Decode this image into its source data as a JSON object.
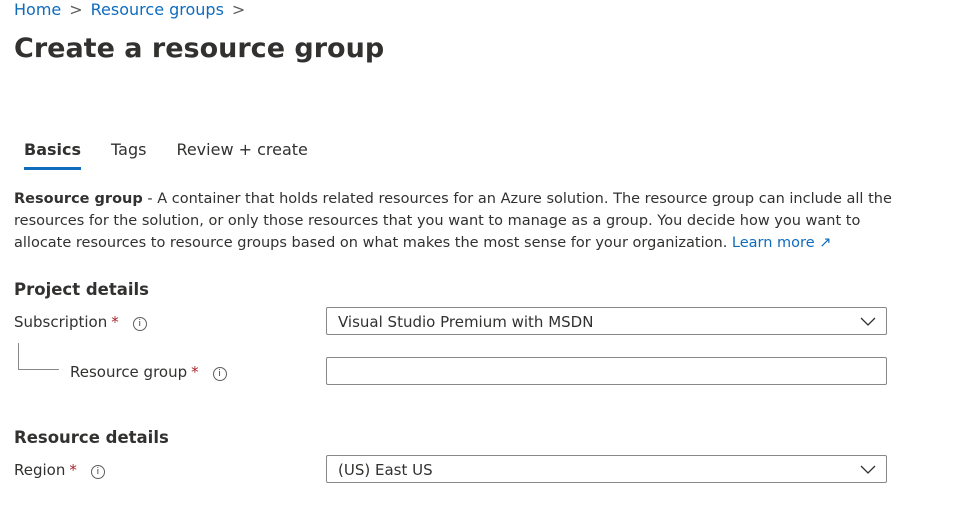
{
  "breadcrumb": [
    {
      "label": "Home"
    },
    {
      "label": "Resource groups"
    }
  ],
  "title": "Create a resource group",
  "tabs": [
    {
      "label": "Basics",
      "active": true
    },
    {
      "label": "Tags"
    },
    {
      "label": "Review + create"
    }
  ],
  "description": {
    "bold": "Resource group",
    "text": " - A container that holds related resources for an Azure solution. The resource group can include all the resources for the solution, or only those resources that you want to manage as a group. You decide how you want to allocate resources to resource groups based on what makes the most sense for your organization. ",
    "link": "Learn more"
  },
  "project_details": {
    "heading": "Project details",
    "subscription": {
      "label": "Subscription",
      "value": "Visual Studio Premium with MSDN"
    },
    "resource_group": {
      "label": "Resource group",
      "value": ""
    }
  },
  "resource_details": {
    "heading": "Resource details",
    "region": {
      "label": "Region",
      "value": "(US) East US"
    }
  },
  "required_mark": "*",
  "info_glyph": "i"
}
